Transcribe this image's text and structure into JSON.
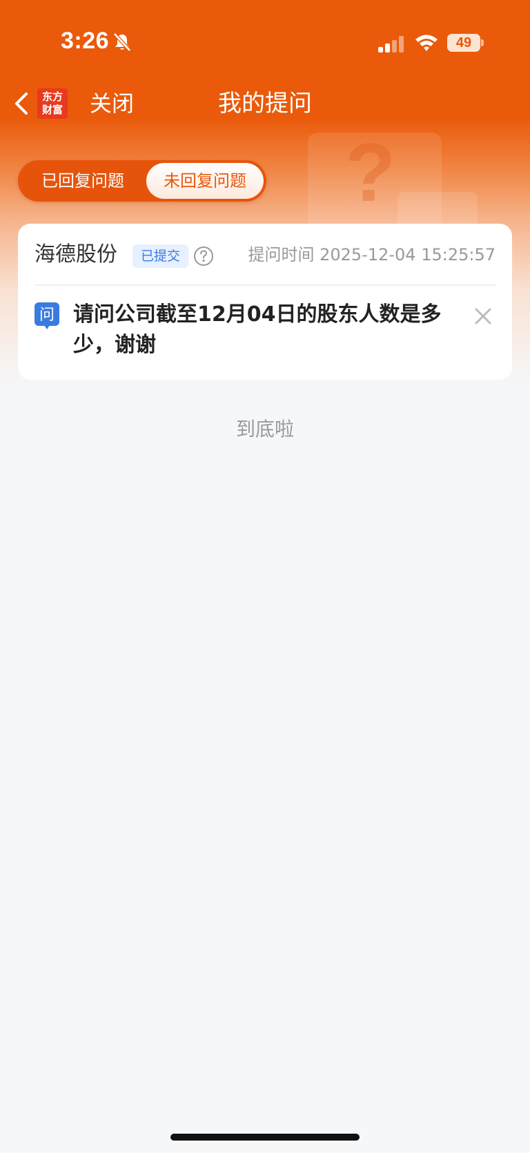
{
  "status_bar": {
    "time": "3:26",
    "battery": "49",
    "icons": [
      "bell-slash-icon",
      "signal-icon",
      "wifi-icon",
      "battery-icon"
    ]
  },
  "nav": {
    "logo_text": "东方财富",
    "logo_line1": "东方",
    "logo_line2": "财富",
    "close_label": "关闭",
    "title": "我的提问"
  },
  "tabs": [
    {
      "label": "已回复问题",
      "active": false
    },
    {
      "label": "未回复问题",
      "active": true
    }
  ],
  "question": {
    "company": "海德股份",
    "status": "已提交",
    "time_label": "提问时间 2025-12-04 15:25:57",
    "icon_char": "问",
    "text": "请问公司截至12月04日的股东人数是多少，谢谢"
  },
  "footer": {
    "end_text": "到底啦"
  },
  "colors": {
    "brand": "#ea5a0a",
    "logo": "#e83a1f",
    "badge_text": "#3a7be0",
    "badge_bg": "#e6f0ff",
    "ask_icon": "#3a7be0"
  }
}
